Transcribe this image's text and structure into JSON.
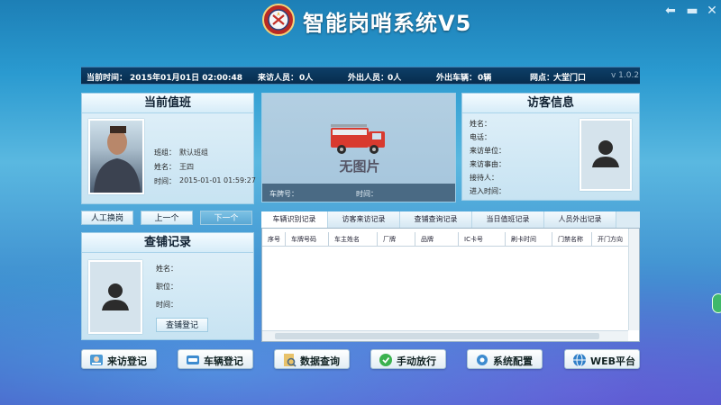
{
  "app": {
    "title": "智能岗哨系统V5",
    "version": "v 1.0.2",
    "controls": {
      "back_icon": "back-arrow-icon",
      "minimize_icon": "minimize-icon"
    }
  },
  "status": {
    "time_label": "当前时间：",
    "time_value": "2015年01月01日 02:00:48",
    "visitors_label": "来访人员：",
    "visitors_value": "0人",
    "out_people_label": "外出人员：",
    "out_people_value": "0人",
    "out_cars_label": "外出车辆：",
    "out_cars_value": "0辆",
    "gate_label": "网点：",
    "gate_value": "大堂门口"
  },
  "duty": {
    "title": "当前值班",
    "group_label": "班组：",
    "group_value": "默认班组",
    "name_label": "姓名：",
    "name_value": "王四",
    "time_label": "时间：",
    "time_value": "2015-01-01 01:59:27"
  },
  "vehicle": {
    "no_image": "无图片",
    "plate_label": "车牌号：",
    "time_label": "时间："
  },
  "visitor": {
    "title": "访客信息",
    "fields": [
      "姓名：",
      "电话：",
      "来访单位：",
      "来访事由：",
      "接待人：",
      "进入时间："
    ]
  },
  "shift_buttons": {
    "manual": "人工换岗",
    "prev": "上一个",
    "next": "下一个"
  },
  "inspection": {
    "title": "查铺记录",
    "name_label": "姓名：",
    "position_label": "职位：",
    "time_label": "时间：",
    "register_button": "查铺登记"
  },
  "tabs": [
    "车辆识别记录",
    "访客来访记录",
    "查铺查询记录",
    "当日值班记录",
    "人员外出记录"
  ],
  "table": {
    "columns": [
      "序号",
      "车牌号码",
      "车主姓名",
      "厂牌",
      "品牌",
      "IC卡号",
      "刷卡时间",
      "门禁名称",
      "开门方向"
    ]
  },
  "bottom_buttons": [
    {
      "label": "来访登记",
      "icon": "visitor-register-icon"
    },
    {
      "label": "车辆登记",
      "icon": "car-register-icon"
    },
    {
      "label": "数据查询",
      "icon": "data-query-icon"
    },
    {
      "label": "手动放行",
      "icon": "manual-release-icon"
    },
    {
      "label": "系统配置",
      "icon": "settings-icon"
    },
    {
      "label": "WEB平台",
      "icon": "web-platform-icon"
    }
  ],
  "colors": {
    "accent": "#2a9ad0",
    "status_bar": "#0d3f68",
    "panel": "#d6ecf8",
    "truck_red": "#d83a2f"
  }
}
